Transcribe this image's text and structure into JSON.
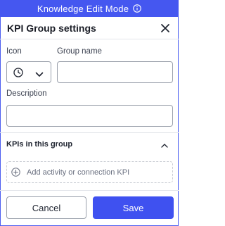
{
  "mode_bar": {
    "text": "Knowledge Edit Mode",
    "icon": "info-icon"
  },
  "dialog": {
    "title": "KPI Group settings",
    "close_icon": "close-icon"
  },
  "form": {
    "icon_label": "Icon",
    "icon_value": "clock-icon",
    "group_name_label": "Group name",
    "group_name_value": "",
    "description_label": "Description",
    "description_value": ""
  },
  "kpis": {
    "section_title": "KPIs in this group",
    "collapse_icon": "chevron-up-icon",
    "add_label": "Add activity or connection KPI",
    "add_icon": "plus-circle-icon"
  },
  "footer": {
    "cancel_label": "Cancel",
    "save_label": "Save"
  },
  "colors": {
    "accent": "#4557f0",
    "primary_button": "#3f51f0",
    "border": "#9aa0ab"
  }
}
